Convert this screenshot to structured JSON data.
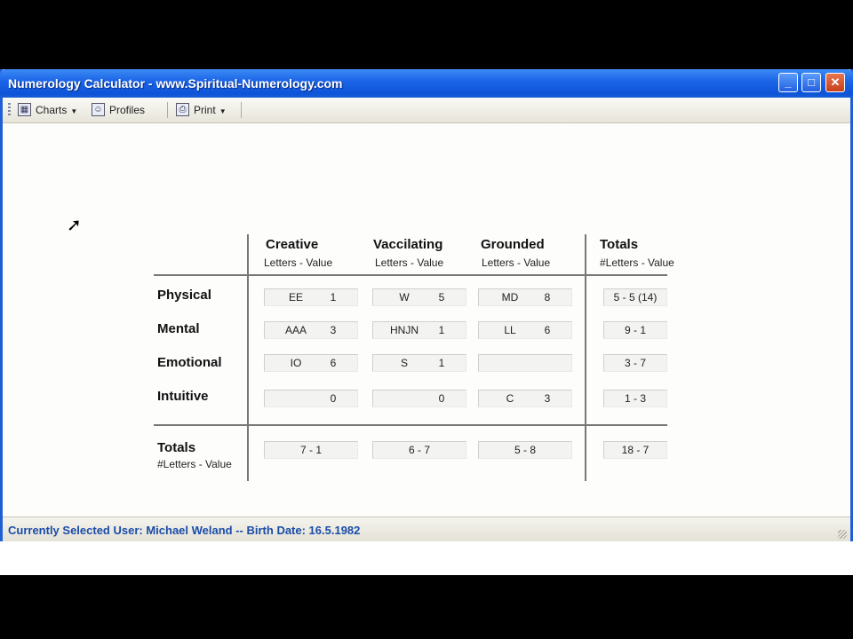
{
  "window": {
    "title": "Numerology Calculator - www.Spiritual-Numerology.com"
  },
  "toolbar": {
    "charts": "Charts",
    "profiles": "Profiles",
    "print": "Print"
  },
  "grid": {
    "columns": [
      {
        "name": "Creative",
        "sub": "Letters - Value"
      },
      {
        "name": "Vaccilating",
        "sub": "Letters - Value"
      },
      {
        "name": "Grounded",
        "sub": "Letters - Value"
      },
      {
        "name": "Totals",
        "sub": "#Letters - Value"
      }
    ],
    "rows": [
      {
        "label": "Physical",
        "cells": [
          [
            "EE",
            "1"
          ],
          [
            "W",
            "5"
          ],
          [
            "MD",
            "8"
          ]
        ],
        "total": "5 - 5 (14)"
      },
      {
        "label": "Mental",
        "cells": [
          [
            "AAA",
            "3"
          ],
          [
            "HNJN",
            "1"
          ],
          [
            "LL",
            "6"
          ]
        ],
        "total": "9 - 1"
      },
      {
        "label": "Emotional",
        "cells": [
          [
            "IO",
            "6"
          ],
          [
            "S",
            "1"
          ],
          [
            "",
            ""
          ]
        ],
        "total": "3 - 7"
      },
      {
        "label": "Intuitive",
        "cells": [
          [
            "",
            "0"
          ],
          [
            "",
            "0"
          ],
          [
            "C",
            "3"
          ]
        ],
        "total": "1 - 3"
      }
    ],
    "totals": {
      "label": "Totals",
      "sub": "#Letters - Value",
      "values": [
        "7 - 1",
        "6 - 7",
        "5 - 8",
        "18 - 7"
      ]
    }
  },
  "status": {
    "text": "Currently Selected User:  Michael Weland  --  Birth Date: 16.5.1982"
  }
}
